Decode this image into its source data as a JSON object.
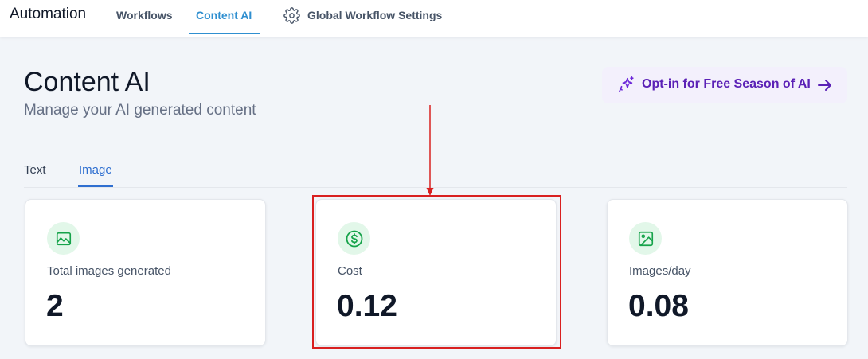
{
  "topnav": {
    "brand": "Automation",
    "links": [
      {
        "label": "Workflows",
        "active": false
      },
      {
        "label": "Content AI",
        "active": true
      },
      {
        "label": "Global Workflow Settings",
        "icon": "gear-icon",
        "active": false
      }
    ]
  },
  "header": {
    "title": "Content AI",
    "subtitle": "Manage your AI generated content",
    "optin_label": "Opt-in for Free Season of AI"
  },
  "tabs": [
    {
      "label": "Text",
      "active": false
    },
    {
      "label": "Image",
      "active": true
    }
  ],
  "cards": [
    {
      "icon": "image-mountain-icon",
      "label": "Total images generated",
      "value": "2"
    },
    {
      "icon": "dollar-circle-icon",
      "label": "Cost",
      "value": "0.12"
    },
    {
      "icon": "image-icon",
      "label": "Images/day",
      "value": "0.08"
    }
  ],
  "colors": {
    "accent_blue": "#2f8fd0",
    "optin_purple": "#5b21b6",
    "icon_green": "#16a34a",
    "annotation_red": "#d92020"
  }
}
